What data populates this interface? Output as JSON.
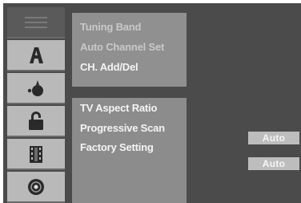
{
  "menu": {
    "top_items": [
      {
        "label": "Tuning Band"
      },
      {
        "label": "Auto Channel Set"
      },
      {
        "label": "CH. Add/Del"
      }
    ],
    "bottom_items": [
      {
        "label": "TV Aspect Ratio"
      },
      {
        "label": "Progressive Scan"
      },
      {
        "label": "Factory Setting"
      }
    ]
  },
  "values": [
    {
      "label": "Auto"
    },
    {
      "label": "Auto"
    }
  ],
  "icons": [
    {
      "name": "general-settings-icon",
      "selected": true
    },
    {
      "name": "language-icon",
      "selected": false
    },
    {
      "name": "audio-icon",
      "selected": false
    },
    {
      "name": "lock-icon",
      "selected": false
    },
    {
      "name": "recording-icon",
      "selected": false
    },
    {
      "name": "disc-icon",
      "selected": false
    }
  ],
  "colors": {
    "background": "#4b4b4b",
    "panel": "#8c8c8c",
    "tab": "#b9b9b9",
    "text_bright": "#f4f4f4",
    "text_dim": "#c9c9c9"
  }
}
